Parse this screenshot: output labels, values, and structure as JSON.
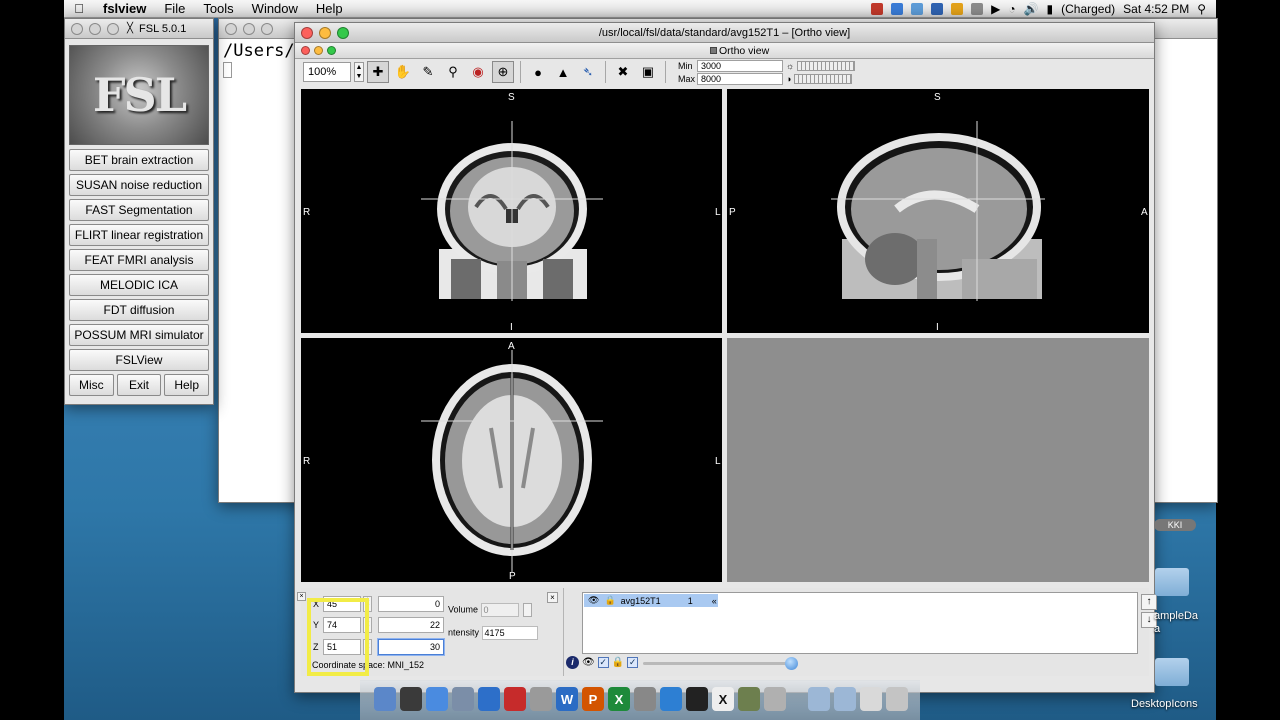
{
  "menubar": {
    "app": "fslview",
    "items": [
      "File",
      "Tools",
      "Window",
      "Help"
    ],
    "battery": "(Charged)",
    "clock": "Sat 4:52 PM"
  },
  "fsl_window": {
    "title": "FSL 5.0.1",
    "logo_text": "FSL",
    "buttons": [
      "BET brain extraction",
      "SUSAN noise reduction",
      "FAST Segmentation",
      "FLIRT linear registration",
      "FEAT FMRI analysis",
      "MELODIC ICA",
      "FDT diffusion",
      "POSSUM MRI simulator",
      "FSLView"
    ],
    "bottom_buttons": [
      "Misc",
      "Exit",
      "Help"
    ]
  },
  "terminal": {
    "text": "/Users/a"
  },
  "ortho_window": {
    "title": "/usr/local/fsl/data/standard/avg152T1 – [Ortho view]",
    "subtitle": "Ortho view",
    "zoom": "100%",
    "min_label": "Min",
    "min_value": "3000",
    "max_label": "Max",
    "max_value": "8000"
  },
  "views": {
    "coronal": {
      "top": "S",
      "bottom": "I",
      "left": "R",
      "right": "L"
    },
    "sagittal": {
      "top": "S",
      "bottom": "I",
      "left": "P",
      "right": "A"
    },
    "axial": {
      "top": "A",
      "bottom": "P",
      "left": "R",
      "right": "L"
    }
  },
  "cursor": {
    "x_label": "X",
    "x": "45",
    "x_mm": "0",
    "y_label": "Y",
    "y": "74",
    "y_mm": "22",
    "z_label": "Z",
    "z": "51",
    "z_mm": "30",
    "coordinate_space": "Coordinate space: MNI_152",
    "volume_label": "Volume",
    "volume": "0",
    "intensity_label": "ntensity",
    "intensity": "4175"
  },
  "layers": {
    "rows": [
      {
        "name": "avg152T1",
        "index": "1"
      }
    ]
  },
  "desktop": {
    "badge": "KKI",
    "item1": "ampleDa",
    "item1b": "a",
    "item2": "DesktopIcons"
  },
  "colors": {
    "highlight": "#f2ec46",
    "selection": "#a9c9f1"
  }
}
